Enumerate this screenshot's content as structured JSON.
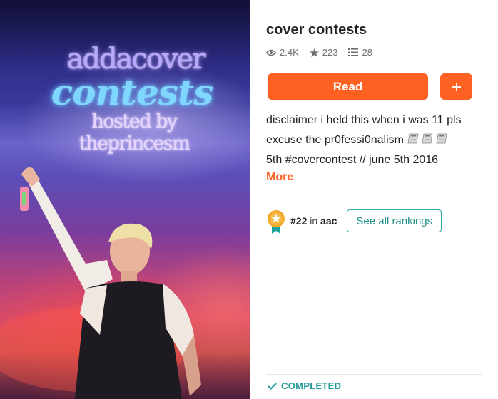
{
  "cover": {
    "line1": "addacover",
    "line2": "contests",
    "line3": "hosted by theprincesm"
  },
  "story": {
    "title": "cover contests",
    "stats": {
      "views": "2.4K",
      "votes": "223",
      "parts": "28"
    },
    "read_label": "Read",
    "add_label": "+",
    "description_line1": "disclaimer i held this when i was 11 pls",
    "description_line2": "excuse the pr0fessi0nalism",
    "description_line3": "5th #covercontest // june 5th 2016",
    "more_label": "More",
    "ranking": {
      "rank": "#22",
      "in_word": "in",
      "tag": "aac",
      "see_all_label": "See all rankings"
    },
    "status": "COMPLETED"
  },
  "colors": {
    "accent": "#ff6122",
    "teal": "#2aa8a1",
    "muted": "#6f6f6f"
  },
  "icons": [
    "eye-icon",
    "star-icon",
    "list-icon",
    "plus-icon",
    "newspaper-emoji",
    "ranking-badge-icon",
    "check-icon"
  ]
}
